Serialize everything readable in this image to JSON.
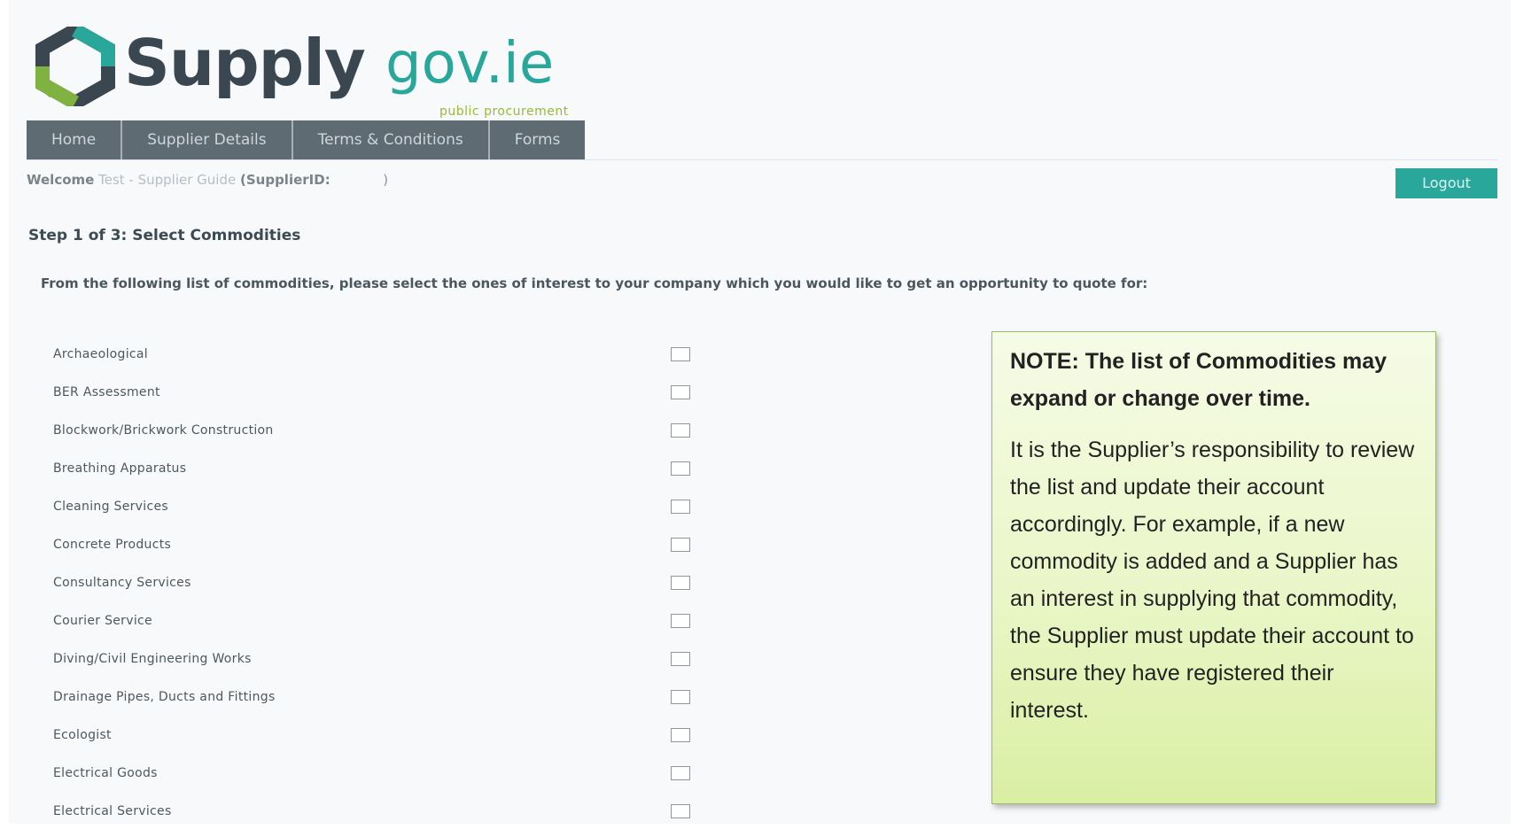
{
  "brand": {
    "word": "Supply",
    "word2": "gov.ie",
    "tagline": "public procurement"
  },
  "nav": {
    "items": [
      "Home",
      "Supplier Details",
      "Terms & Conditions",
      "Forms"
    ]
  },
  "welcome": {
    "prefix": "Welcome",
    "user": "Test - Supplier Guide",
    "id_label": "(SupplierID:",
    "id_close": ")"
  },
  "logout_label": "Logout",
  "step_title": "Step 1 of 3: Select Commodities",
  "instructions": "From the following list of commodities, please select the ones of interest to your company which you would like to get an opportunity to quote for:",
  "commodities": [
    {
      "label": "Archaeological",
      "checked": false
    },
    {
      "label": "BER Assessment",
      "checked": false
    },
    {
      "label": "Blockwork/Brickwork Construction",
      "checked": false
    },
    {
      "label": "Breathing Apparatus",
      "checked": false
    },
    {
      "label": "Cleaning Services",
      "checked": false
    },
    {
      "label": "Concrete Products",
      "checked": false
    },
    {
      "label": "Consultancy Services",
      "checked": false
    },
    {
      "label": "Courier Service",
      "checked": false
    },
    {
      "label": "Diving/Civil Engineering Works",
      "checked": false
    },
    {
      "label": "Drainage Pipes, Ducts and Fittings",
      "checked": false
    },
    {
      "label": "Ecologist",
      "checked": false
    },
    {
      "label": "Electrical Goods",
      "checked": false
    },
    {
      "label": "Electrical Services",
      "checked": false
    }
  ],
  "note": {
    "heading": "NOTE: The list of Commodities may expand or change over time.",
    "body": "It is the Supplier’s responsibility to review the list and update their account accordingly. For example, if a new commodity is added and a Supplier has an interest in supplying that commodity, the Supplier must update their account to ensure they have registered their interest."
  },
  "colors": {
    "brand_teal": "#2aa79b",
    "brand_dark": "#3a4750",
    "brand_green": "#9ab83a",
    "nav_bg": "#5e6b73",
    "note_bg": "#eaf6c8"
  }
}
